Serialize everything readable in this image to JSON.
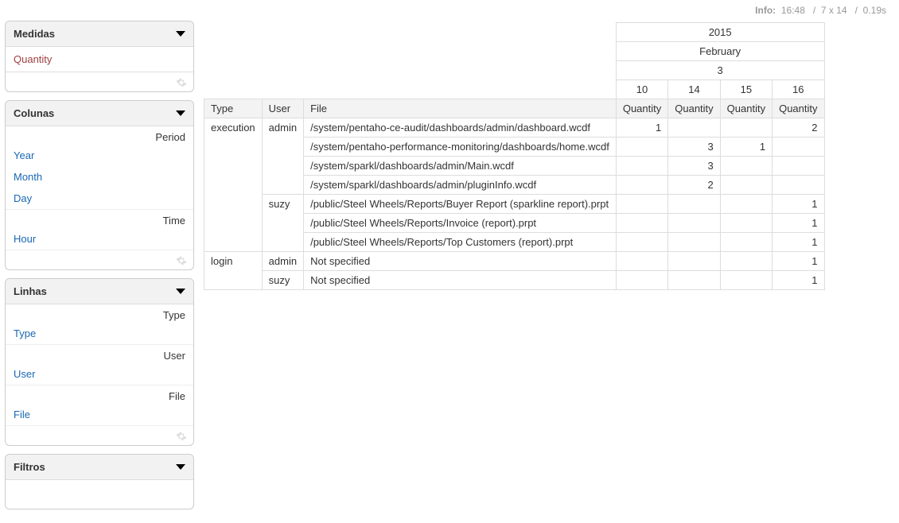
{
  "info": {
    "label": "Info:",
    "time": "16:48",
    "sep1": "/",
    "dims": "7 x 14",
    "sep2": "/",
    "dur": "0.19s"
  },
  "panels": {
    "measures": {
      "title": "Medidas",
      "items": [
        "Quantity"
      ]
    },
    "columns": {
      "title": "Colunas",
      "groups": [
        {
          "label": "Period",
          "items": [
            "Year",
            "Month",
            "Day"
          ]
        },
        {
          "label": "Time",
          "items": [
            "Hour"
          ]
        }
      ]
    },
    "rows": {
      "title": "Linhas",
      "groups": [
        {
          "label": "Type",
          "items": [
            "Type"
          ]
        },
        {
          "label": "User",
          "items": [
            "User"
          ]
        },
        {
          "label": "File",
          "items": [
            "File"
          ]
        }
      ]
    },
    "filters": {
      "title": "Filtros"
    }
  },
  "pivot": {
    "col_levels": {
      "year": "2015",
      "month": "February",
      "day": "3",
      "hours": [
        "10",
        "14",
        "15",
        "16"
      ],
      "measure": "Quantity"
    },
    "row_headers": [
      "Type",
      "User",
      "File"
    ],
    "rows": [
      {
        "type": "execution",
        "user": "admin",
        "file": "/system/pentaho-ce-audit/dashboards/admin/dashboard.wcdf",
        "v": [
          "1",
          "",
          "",
          "2"
        ]
      },
      {
        "type": "",
        "user": "",
        "file": "/system/pentaho-performance-monitoring/dashboards/home.wcdf",
        "v": [
          "",
          "3",
          "1",
          ""
        ]
      },
      {
        "type": "",
        "user": "",
        "file": "/system/sparkl/dashboards/admin/Main.wcdf",
        "v": [
          "",
          "3",
          "",
          ""
        ]
      },
      {
        "type": "",
        "user": "",
        "file": "/system/sparkl/dashboards/admin/pluginInfo.wcdf",
        "v": [
          "",
          "2",
          "",
          ""
        ]
      },
      {
        "type": "",
        "user": "suzy",
        "file": "/public/Steel Wheels/Reports/Buyer Report (sparkline report).prpt",
        "v": [
          "",
          "",
          "",
          "1"
        ]
      },
      {
        "type": "",
        "user": "",
        "file": "/public/Steel Wheels/Reports/Invoice (report).prpt",
        "v": [
          "",
          "",
          "",
          "1"
        ]
      },
      {
        "type": "",
        "user": "",
        "file": "/public/Steel Wheels/Reports/Top Customers (report).prpt",
        "v": [
          "",
          "",
          "",
          "1"
        ]
      },
      {
        "type": "login",
        "user": "admin",
        "file": "Not specified",
        "v": [
          "",
          "",
          "",
          "1"
        ]
      },
      {
        "type": "",
        "user": "suzy",
        "file": "Not specified",
        "v": [
          "",
          "",
          "",
          "1"
        ]
      }
    ],
    "spans": {
      "type": [
        {
          "start": 0,
          "span": 7
        },
        {
          "start": 7,
          "span": 2
        }
      ],
      "user": [
        {
          "start": 0,
          "span": 4
        },
        {
          "start": 4,
          "span": 3
        },
        {
          "start": 7,
          "span": 1
        },
        {
          "start": 8,
          "span": 1
        }
      ]
    }
  }
}
